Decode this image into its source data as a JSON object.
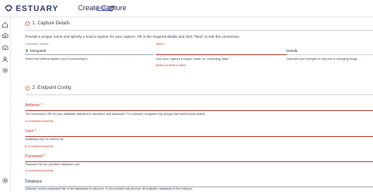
{
  "header": {
    "logo_text": "ESTUARY",
    "title": "Create Capture",
    "docs_label": "DOCS"
  },
  "sidebar": {
    "items": [
      {
        "icon": "home-icon"
      },
      {
        "icon": "cloud-upload-icon"
      },
      {
        "icon": "cloud-download-icon"
      },
      {
        "icon": "admin-icon"
      },
      {
        "icon": "settings-icon"
      }
    ],
    "bottom_icon": "gear-icon"
  },
  "capture_details": {
    "heading": "1. Capture Details",
    "intro": "Provide a unique name and specify a source system for your capture. Fill in the required details and click \"Next\" to test the connection.",
    "connector": {
      "label": "Connector Search *",
      "value": "MongoDB",
      "help": "Select the external system you're connecting to."
    },
    "name": {
      "label": "Name *",
      "help": "Give your Capture a unique name, ex: marketing_data/.",
      "error": "please provide a name"
    },
    "details": {
      "label": "Details",
      "help": "Describe your changes or why you're changing things."
    }
  },
  "endpoint_config": {
    "heading": "2. Endpoint Config",
    "fields": [
      {
        "label": "Address *",
        "help": "The connection URI for your database without the username and password. For example mongodb://my-mongo.test?authSource=admin.",
        "error": "is a required property"
      },
      {
        "label": "User *",
        "help": "Database user to connect as.",
        "error": "is a required property"
      },
      {
        "label": "Password *",
        "help": "Password for the specified database user.",
        "error": "is a required property"
      },
      {
        "label": "Database",
        "help": "Optional comma-separated list of the databases to discover. If not provided will discover all available databases in the instance.",
        "error": ""
      }
    ]
  },
  "colors": {
    "brand": "#2b2e6b",
    "accent": "#5a66e0",
    "error": "#c0392b"
  }
}
